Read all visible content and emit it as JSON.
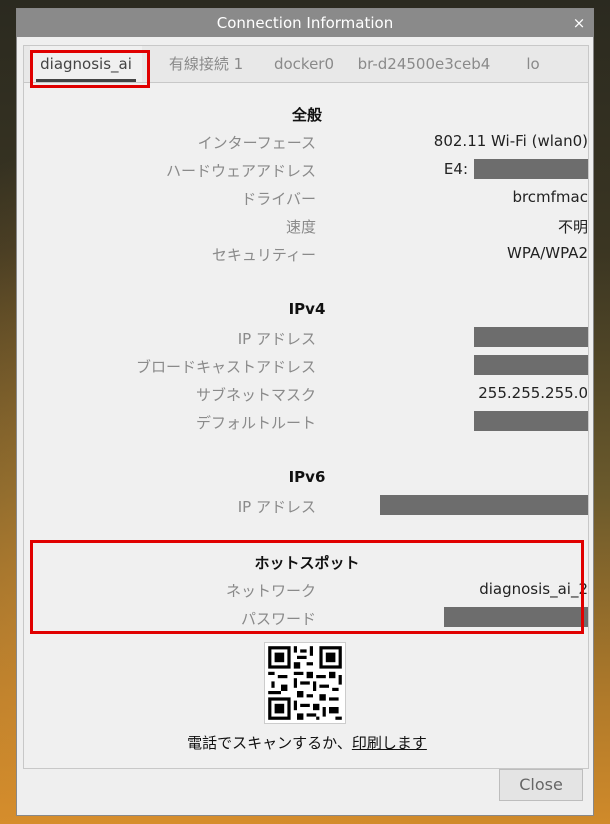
{
  "window": {
    "title": "Connection Information",
    "close_glyph": "×"
  },
  "tabs": [
    {
      "label": "diagnosis_ai"
    },
    {
      "label": "有線接続 1"
    },
    {
      "label": "docker0"
    },
    {
      "label": "br-d24500e3ceb4"
    },
    {
      "label": "lo"
    }
  ],
  "general": {
    "title": "全般",
    "rows": [
      {
        "label": "インターフェース",
        "value": "802.11 Wi-Fi (wlan0)"
      },
      {
        "label": "ハードウェアアドレス",
        "value": "E4:"
      },
      {
        "label": "ドライバー",
        "value": "brcmfmac"
      },
      {
        "label": "速度",
        "value": "不明"
      },
      {
        "label": "セキュリティー",
        "value": "WPA/WPA2"
      }
    ]
  },
  "ipv4": {
    "title": "IPv4",
    "rows": [
      {
        "label": "IP アドレス",
        "value": ""
      },
      {
        "label": "ブロードキャストアドレス",
        "value": ""
      },
      {
        "label": "サブネットマスク",
        "value": "255.255.255.0"
      },
      {
        "label": "デフォルトルート",
        "value": ""
      }
    ]
  },
  "ipv6": {
    "title": "IPv6",
    "rows": [
      {
        "label": "IP アドレス",
        "value": ""
      }
    ]
  },
  "hotspot": {
    "title": "ホットスポット",
    "rows": [
      {
        "label": "ネットワーク",
        "value": "diagnosis_ai_2"
      },
      {
        "label": "パスワード",
        "value": ""
      }
    ]
  },
  "qr": {
    "scan_text": "電話でスキャンするか、",
    "print_link": "印刷します"
  },
  "footer": {
    "close_label": "Close"
  },
  "colors": {
    "highlight": "#e00000",
    "redaction": "#6d6d6d",
    "titlebar": "#8a8a8a"
  }
}
